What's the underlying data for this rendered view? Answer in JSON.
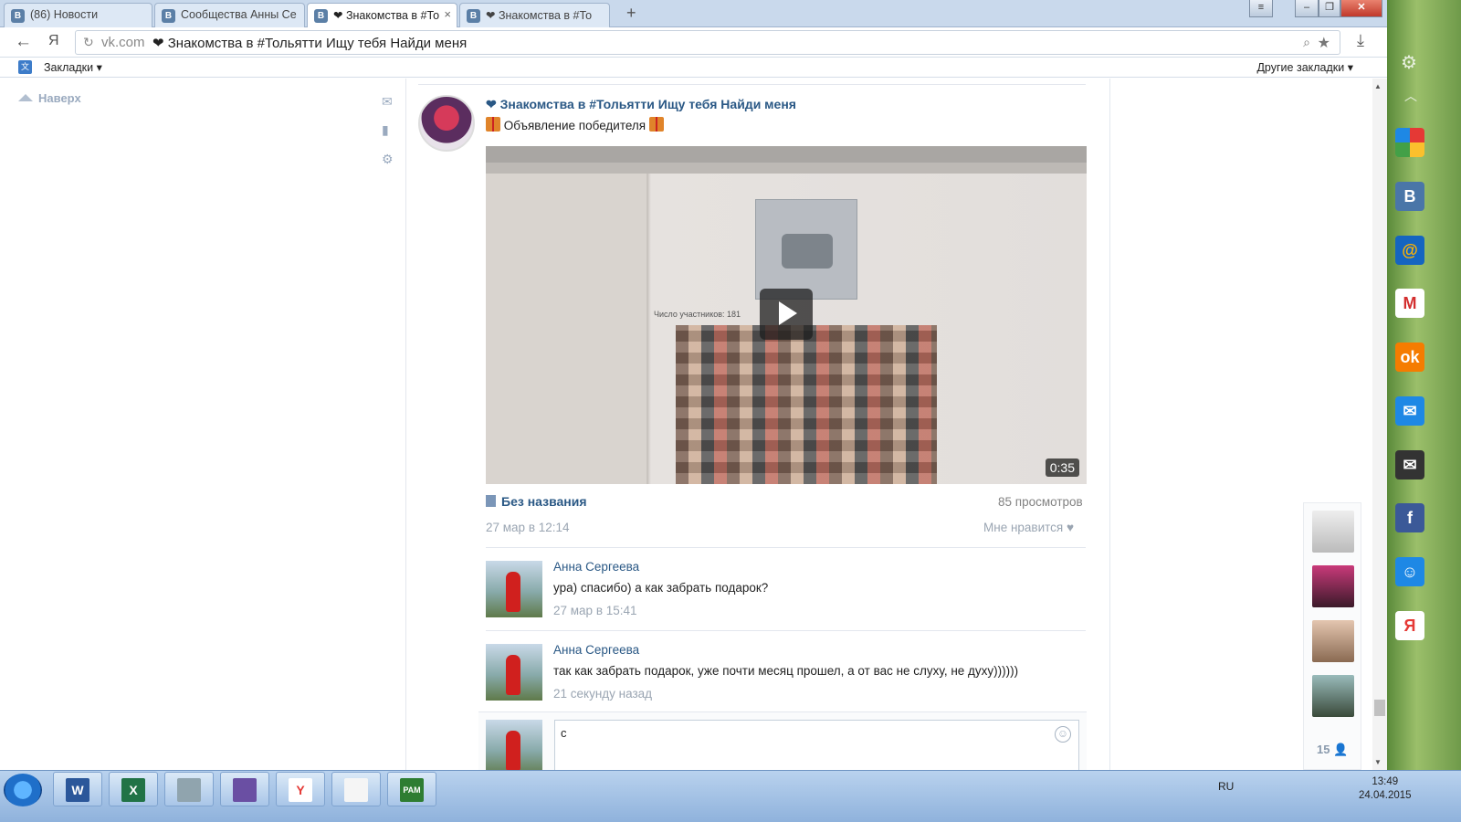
{
  "browser": {
    "tabs": [
      {
        "label": "(86) Новости",
        "active": false
      },
      {
        "label": "Сообщества Анны Се",
        "active": false
      },
      {
        "label": "❤ Знакомства в #То",
        "active": true
      },
      {
        "label": "❤ Знакомства в #То",
        "active": false
      }
    ],
    "favicon_letter": "B",
    "close_glyph": "×",
    "newtab_glyph": "+",
    "address": {
      "domain": "vk.com",
      "title": "❤ Знакомства в #Тольятти Ищу тебя Найди меня",
      "yandex_glyph": "Я"
    },
    "bookmarks": {
      "label": "Закладки ▾",
      "other": "Другие закладки ▾"
    }
  },
  "sidebar": {
    "back_to_top": "Наверх"
  },
  "post": {
    "group_title": "❤ Знакомства в #Тольятти Ищу тебя Найди меня",
    "subtitle": "Объявление победителя",
    "video": {
      "duration": "0:35",
      "participants_text": "Число участников: 181",
      "name": "Без названия",
      "views": "85 просмотров"
    },
    "date": "27 мар в 12:14",
    "like_label": "Мне нравится"
  },
  "comments": [
    {
      "author": "Анна Сергеева",
      "text": "ура) спасибо) а как забрать подарок?",
      "time": "27 мар в 15:41"
    },
    {
      "author": "Анна Сергеева",
      "text": "так как забрать подарок, уже почти месяц прошел, а от вас не слуху, не духу))))))",
      "time": "21 секунду назад"
    }
  ],
  "reply": {
    "value": "с"
  },
  "friends": {
    "count": "15"
  },
  "taskbar": {
    "lang": "RU",
    "time": "13:49",
    "date": "24.04.2015",
    "apps": [
      "W",
      "X",
      "",
      "",
      "Y",
      "",
      "PAM"
    ]
  },
  "colors": {
    "link": "#2a5885",
    "muted": "#9aa5b2",
    "accent": "#5b7fa6"
  }
}
